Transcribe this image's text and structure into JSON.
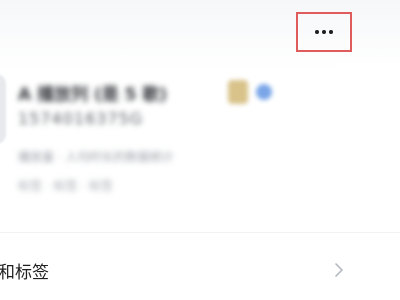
{
  "header": {
    "more_button": {
      "label": "···",
      "icon": "more-horizontal-icon",
      "highlight_color": "#e05b5b"
    }
  },
  "profile": {
    "name": "A 播放列 (是 5 歌)",
    "id": "1574016375G",
    "meta": "播放量 · 人均时长的数据统计",
    "tags": "标签 · 标签 · 标签",
    "badge_icon": "trophy-icon",
    "verified_icon": "verified-icon"
  },
  "menu": {
    "row_label": "和标签",
    "row_icon": "chevron-right-icon"
  }
}
